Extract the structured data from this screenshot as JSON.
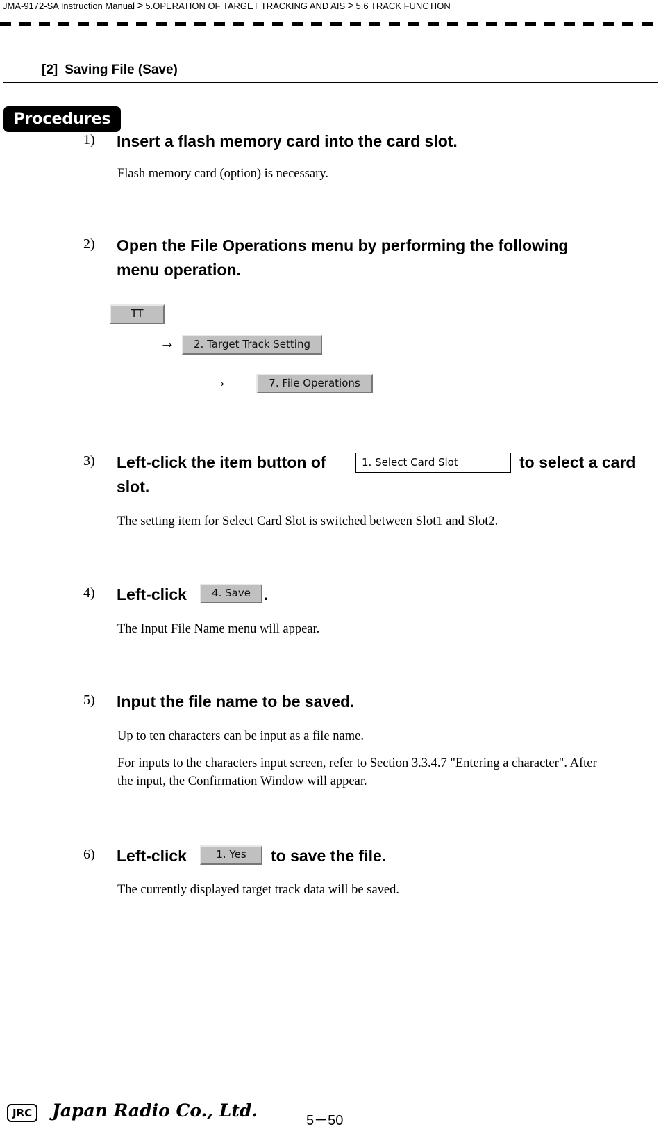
{
  "header": {
    "breadcrumb": [
      "JMA-9172-SA Instruction Manual",
      "5.OPERATION OF TARGET TRACKING AND AIS",
      "5.6  TRACK FUNCTION"
    ],
    "separator": ">"
  },
  "section": {
    "number": "[2]",
    "title": "Saving File (Save)"
  },
  "procedures_label": "Procedures",
  "steps": [
    {
      "num": "1)",
      "heading": "Insert a flash memory card into the card slot.",
      "body": [
        "Flash memory card (option) is necessary."
      ]
    },
    {
      "num": "2)",
      "heading_line1": "Open the File Operations menu by performing the following",
      "heading_line2": "menu operation."
    },
    {
      "num": "3)",
      "heading_pre": "Left-click the item button of",
      "heading_post": "to select a card",
      "heading_line2": "slot.",
      "body": [
        "The setting item for Select Card Slot is switched between Slot1 and Slot2."
      ]
    },
    {
      "num": "4)",
      "heading_pre": "Left-click",
      "heading_post": ".",
      "body": [
        "The Input File Name menu will appear."
      ]
    },
    {
      "num": "5)",
      "heading": "Input the file name to be saved.",
      "body": [
        "Up to ten characters can be input as a file name.",
        "For inputs to the characters input screen, refer to Section 3.3.4.7 \"Entering a character\". After",
        "the input, the Confirmation Window will appear."
      ]
    },
    {
      "num": "6)",
      "heading_pre": "Left-click",
      "heading_post": "to save the file.",
      "body": [
        "The currently displayed target track data will be saved."
      ]
    }
  ],
  "menu_path": {
    "arrow": "→",
    "buttons": [
      "TT",
      "2. Target Track Setting",
      "7. File Operations"
    ]
  },
  "ui_buttons": {
    "select_card_slot": "1. Select Card Slot",
    "save": "4. Save",
    "yes": "1. Yes"
  },
  "footer": {
    "logo": "JRC",
    "company": "Japan Radio Co., Ltd.",
    "page": "5－50"
  }
}
